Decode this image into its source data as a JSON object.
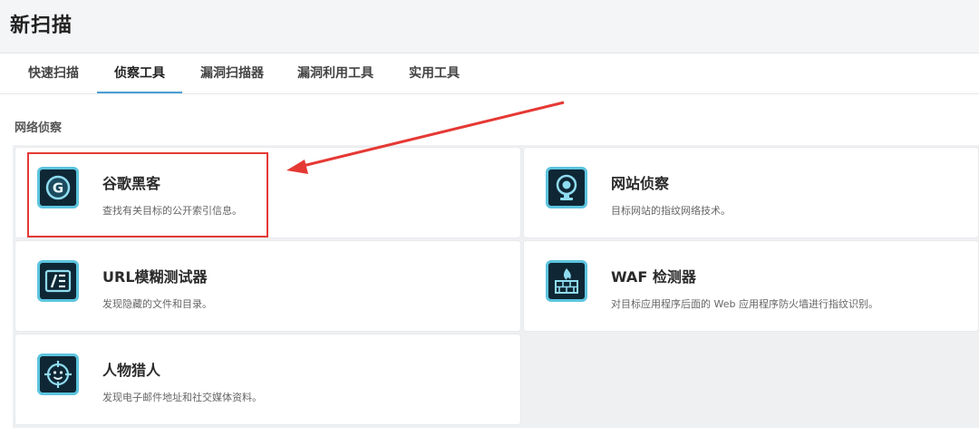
{
  "page": {
    "title": "新扫描"
  },
  "tabs": [
    {
      "label": "快速扫描",
      "active": false
    },
    {
      "label": "侦察工具",
      "active": true
    },
    {
      "label": "漏洞扫描器",
      "active": false
    },
    {
      "label": "漏洞利用工具",
      "active": false
    },
    {
      "label": "实用工具",
      "active": false
    }
  ],
  "section": {
    "title": "网络侦察"
  },
  "tools": [
    {
      "name": "谷歌黑客",
      "desc": "查找有关目标的公开索引信息。",
      "icon": "google-icon"
    },
    {
      "name": "网站侦察",
      "desc": "目标网站的指纹网络技术。",
      "icon": "webcam-icon"
    },
    {
      "name": "URL模糊测试器",
      "desc": "发现隐藏的文件和目录。",
      "icon": "url-fuzzer-icon"
    },
    {
      "name": "WAF 检测器",
      "desc": "对目标应用程序后面的 Web 应用程序防火墙进行指纹识别。",
      "icon": "firewall-icon"
    },
    {
      "name": "人物猎人",
      "desc": "发现电子邮件地址和社交媒体资料。",
      "icon": "crosshair-face-icon"
    }
  ],
  "colors": {
    "accent": "#4a9fd8",
    "icon_bg": "#0f2735",
    "icon_border": "#5cc4de",
    "highlight": "#e53935"
  }
}
